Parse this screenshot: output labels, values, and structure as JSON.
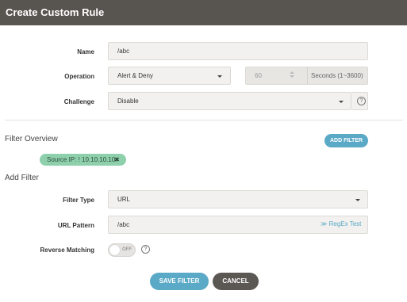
{
  "header": {
    "title": "Create Custom Rule"
  },
  "form": {
    "name": {
      "label": "Name",
      "value": "/abc"
    },
    "operation": {
      "label": "Operation",
      "value": "Alert & Deny",
      "seconds_value": "60",
      "seconds_suffix": "Seconds (1~3600)"
    },
    "challenge": {
      "label": "Challenge",
      "value": "Disable",
      "help": "?"
    }
  },
  "filter_overview": {
    "title": "Filter Overview",
    "add_button": "ADD FILTER",
    "chips": [
      {
        "text": "Source IP:  ! 10.10.10.10",
        "remove": "✖"
      }
    ]
  },
  "add_filter": {
    "title": "Add Filter",
    "filter_type": {
      "label": "Filter Type",
      "value": "URL"
    },
    "url_pattern": {
      "label": "URL Pattern",
      "value": "/abc",
      "regex_link": "≫ RegEx Test"
    },
    "reverse_matching": {
      "label": "Reverse Matching",
      "toggle": "OFF",
      "help": "?"
    }
  },
  "footer": {
    "save": "SAVE FILTER",
    "cancel": "CANCEL"
  },
  "colors": {
    "header_bg": "#58544f",
    "accent": "#5aa9c6",
    "chip": "#8ed0ac",
    "dark_button": "#5b5752"
  }
}
